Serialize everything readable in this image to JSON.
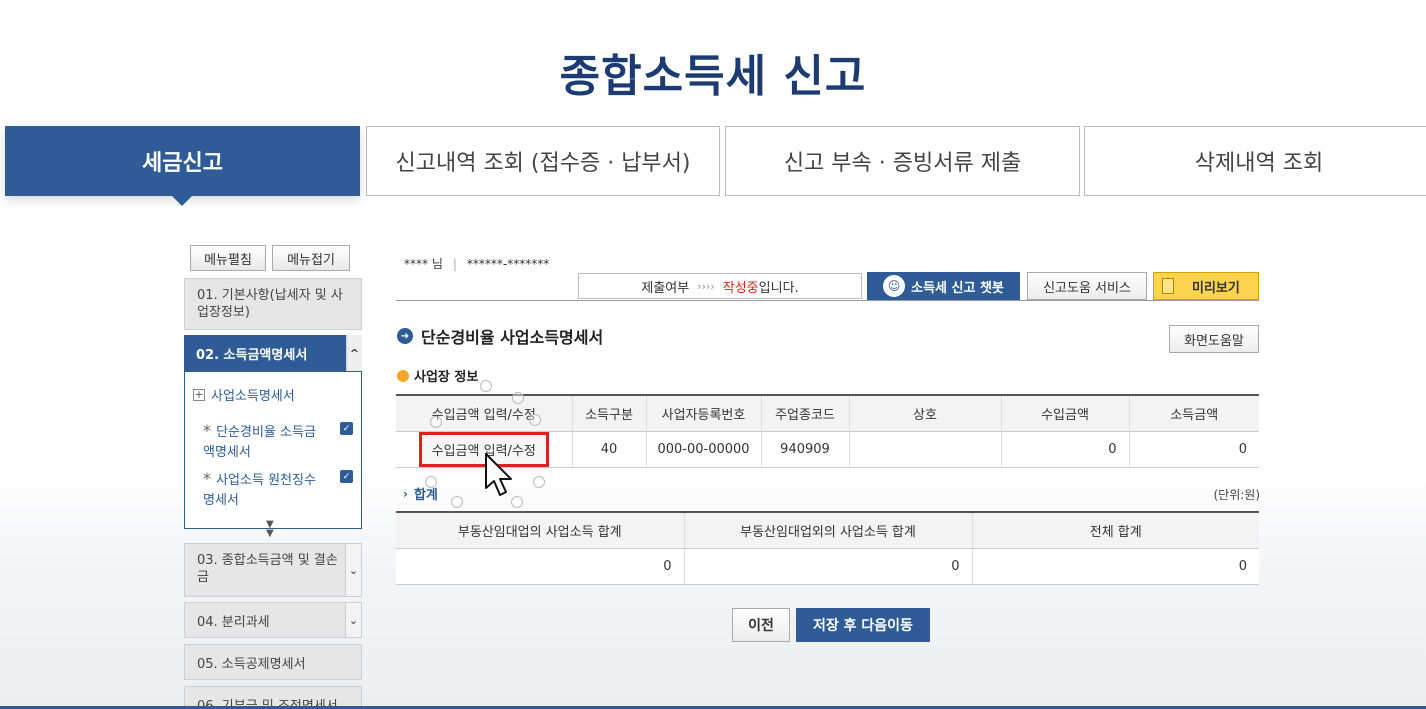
{
  "page": {
    "title": "종합소득세 신고"
  },
  "top_tabs": [
    {
      "label": "세금신고",
      "active": true
    },
    {
      "label": "신고내역 조회 (접수증 · 납부서)",
      "active": false
    },
    {
      "label": "신고 부속 · 증빙서류 제출",
      "active": false
    },
    {
      "label": "삭제내역 조회",
      "active": false
    }
  ],
  "sidebar": {
    "edit_menu_label": "메뉴펼침",
    "collapse_menu_label": "메뉴접기",
    "items": [
      {
        "label": "01. 기본사항(납세자 및 사업장정보)"
      },
      {
        "label": "02. 소득금액명세서",
        "active": true
      },
      {
        "label": "03. 종합소득금액 및 결손금"
      },
      {
        "label": "04. 분리과세"
      },
      {
        "label": "05. 소득공제명세서"
      },
      {
        "label": "06. 기부금 및 조정명세서"
      }
    ],
    "sub_group_label": "사업소득명세서",
    "sub_items": [
      {
        "label": "단순경비율 소득금액명세서"
      },
      {
        "label": "사업소득 원천징수명세서"
      }
    ]
  },
  "user": {
    "name": "**** 님",
    "id": "******-*******"
  },
  "status_bar": {
    "prefix": "제출여부",
    "arrows": "››››",
    "status": "작성중",
    "suffix": "입니다."
  },
  "actions": {
    "chatbot_label": "소득세 신고 챗봇",
    "help_service_label": "신고도움 서비스",
    "preview_label": "미리보기",
    "screen_help_label": "화면도움말"
  },
  "section": {
    "title": "단순경비율 사업소득명세서",
    "subtitle": "사업장 정보",
    "columns": [
      "수입금액 입력/수정",
      "소득구분",
      "사업자등록번호",
      "주업종코드",
      "상호",
      "수입금액",
      "소득금액"
    ],
    "row": {
      "button_label": "수입금액 입력/수정",
      "income_type": "40",
      "business_no": "000-00-00000",
      "industry_code": "940909",
      "company": "",
      "revenue": "0",
      "income": "0"
    }
  },
  "totals": {
    "label": "합계",
    "unit": "(단위:원)",
    "columns": [
      "부동산임대업의 사업소득 합계",
      "부동산임대업외의 사업소득 합계",
      "전체 합계"
    ],
    "values": [
      "0",
      "0",
      "0"
    ]
  },
  "footer": {
    "prev_label": "이전",
    "next_label": "저장 후 다음이동"
  },
  "colors": {
    "brand": "#2f5c96",
    "title": "#1d3b73",
    "status": "#e02020",
    "highlight": "#e02020",
    "preview_bg": "#fbd34d"
  }
}
